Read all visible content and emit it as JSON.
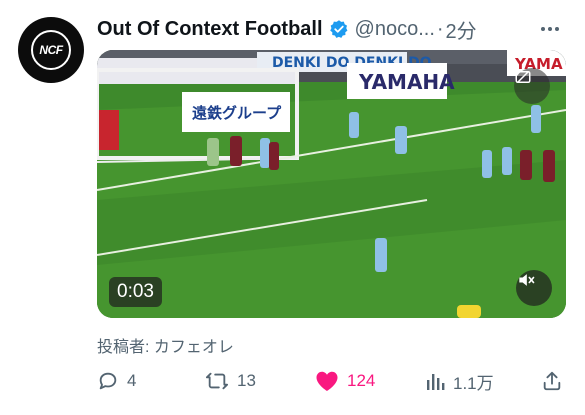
{
  "tweet": {
    "avatar_text": "NCF",
    "display_name": "Out Of Context Football",
    "handle": "@noco...",
    "separator": "·",
    "time": "2分"
  },
  "media": {
    "timecode": "0:03",
    "ad_boards": [
      "遠鉄グループ",
      "YAMAHA",
      "DENKI DO DENKI DO",
      "YAMA"
    ]
  },
  "credit": "投稿者: カフェオレ",
  "actions": {
    "replies": "4",
    "reposts": "13",
    "likes": "124",
    "views": "1.1万"
  },
  "colors": {
    "like": "#f91880",
    "verified": "#1d9bf0",
    "muted_text": "#536471"
  }
}
